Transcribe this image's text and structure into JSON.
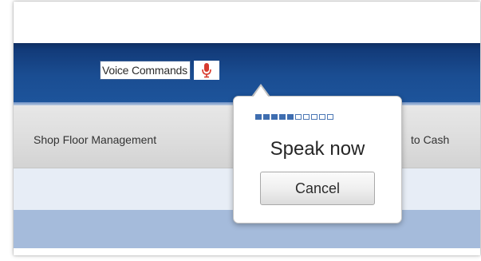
{
  "header": {
    "voice_field_label": "Voice Commands",
    "mic_icon": "microphone-icon"
  },
  "nav": {
    "left_item": "Shop Floor Management",
    "right_item": "to Cash"
  },
  "voice_popup": {
    "level_meter": {
      "segments": 10,
      "active": 5
    },
    "prompt": "Speak now",
    "cancel_label": "Cancel"
  },
  "colors": {
    "header_blue": "#1a4d92",
    "nav_gray": "#dedede",
    "light_row": "#e7edf6",
    "blue_row": "#a5bbdb",
    "mic_red": "#d83a2e",
    "meter_blue": "#3f6eb0"
  }
}
